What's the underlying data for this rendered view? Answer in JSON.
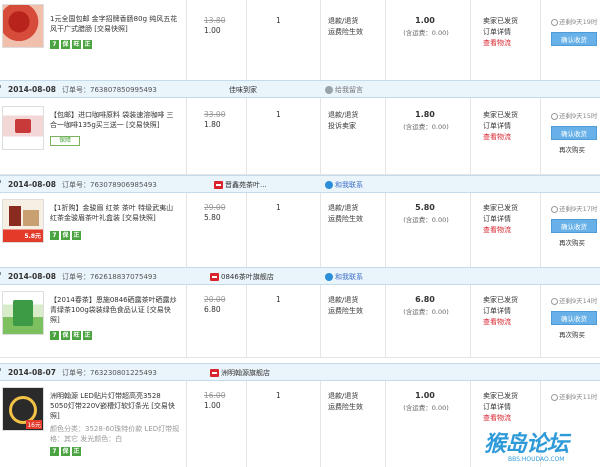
{
  "common": {
    "order_label": "订单号：",
    "confirm_label": "确认收货",
    "rebuy_label": "再次购买",
    "view_logistics": "查看物流",
    "order_detail": "订单详情",
    "seller_shipped": "卖家已发货",
    "refund": "退款/退货",
    "insurance": "运费险生效",
    "complaint": "投诉卖家",
    "shipping": "(含运费：0.00)",
    "contact_label": "和我联系",
    "contact_gray": "给我留言",
    "badge_7": "7",
    "badge_zheng": "正",
    "badge_bao": "保",
    "badge_wang": "旺"
  },
  "orders": [
    {
      "date": "",
      "order_no": "",
      "shop": "",
      "title": "1元全国包邮 金字招牌香肠80g 纯风五花风干广式腊肠 [交易快照]",
      "sub": "",
      "price_old": "13.80",
      "price_new": "1.00",
      "qty": "1",
      "total": "1.00",
      "timer": "还剩9天19时",
      "svc_complaint": false,
      "rebuy": false
    },
    {
      "date": "2014-08-08",
      "order_no": "763807850995493",
      "shop": "佳味到家",
      "title": "【包邮】进口咖啡原料 袋装速溶咖啡 三合一咖啡135g买三送一 [交易快照]",
      "sub": "",
      "price_old": "33.00",
      "price_new": "1.80",
      "qty": "1",
      "total": "1.80",
      "timer": "还剩9天15时",
      "svc_complaint": true,
      "rebuy": true
    },
    {
      "date": "2014-08-08",
      "order_no": "763078906985493",
      "shop": "晋鑫苑茶叶...",
      "title": "【1折购】金骏眉 红茶 茶叶 特级武夷山红茶金骏眉茶叶礼盒装 [交易快照]",
      "sub": "",
      "price_old": "29.00",
      "price_new": "5.80",
      "qty": "1",
      "total": "5.80",
      "timer": "还剩9天17时",
      "svc_complaint": false,
      "rebuy": true
    },
    {
      "date": "2014-08-08",
      "order_no": "762618837075493",
      "shop": "0846茶叶旗舰店",
      "title": "【2014春茶】恩施0846硒露茶叶硒露炒青绿茶100g袋装绿色食品认证 [交易快照]",
      "sub": "",
      "price_old": "20.00",
      "price_new": "6.80",
      "qty": "1",
      "total": "6.80",
      "timer": "还剩9天14时",
      "svc_complaint": false,
      "rebuy": true
    },
    {
      "date": "2014-08-07",
      "order_no": "763230801225493",
      "shop": "洲明翰源旗舰店",
      "title": "洲明翰源 LED贴片灯带超高亮3528 5050灯带220V嵌槽灯软灯条光 [交易快照]",
      "sub": "颜色分类：3528-60珠特价款 LED灯带规格：其它 发光颜色：白",
      "price_old": "16.00",
      "price_new": "1.00",
      "qty": "1",
      "total": "1.00",
      "timer": "还剩9天11时",
      "svc_complaint": false,
      "rebuy": false
    }
  ],
  "watermark": {
    "big": "猴岛论坛",
    "small": "BBS.HOUDAO.COM"
  },
  "colors": {
    "header_bg": "#eaf4fb",
    "button": "#68b1e8",
    "link_red": "#d9232d",
    "badge_green": "#4aa340"
  }
}
